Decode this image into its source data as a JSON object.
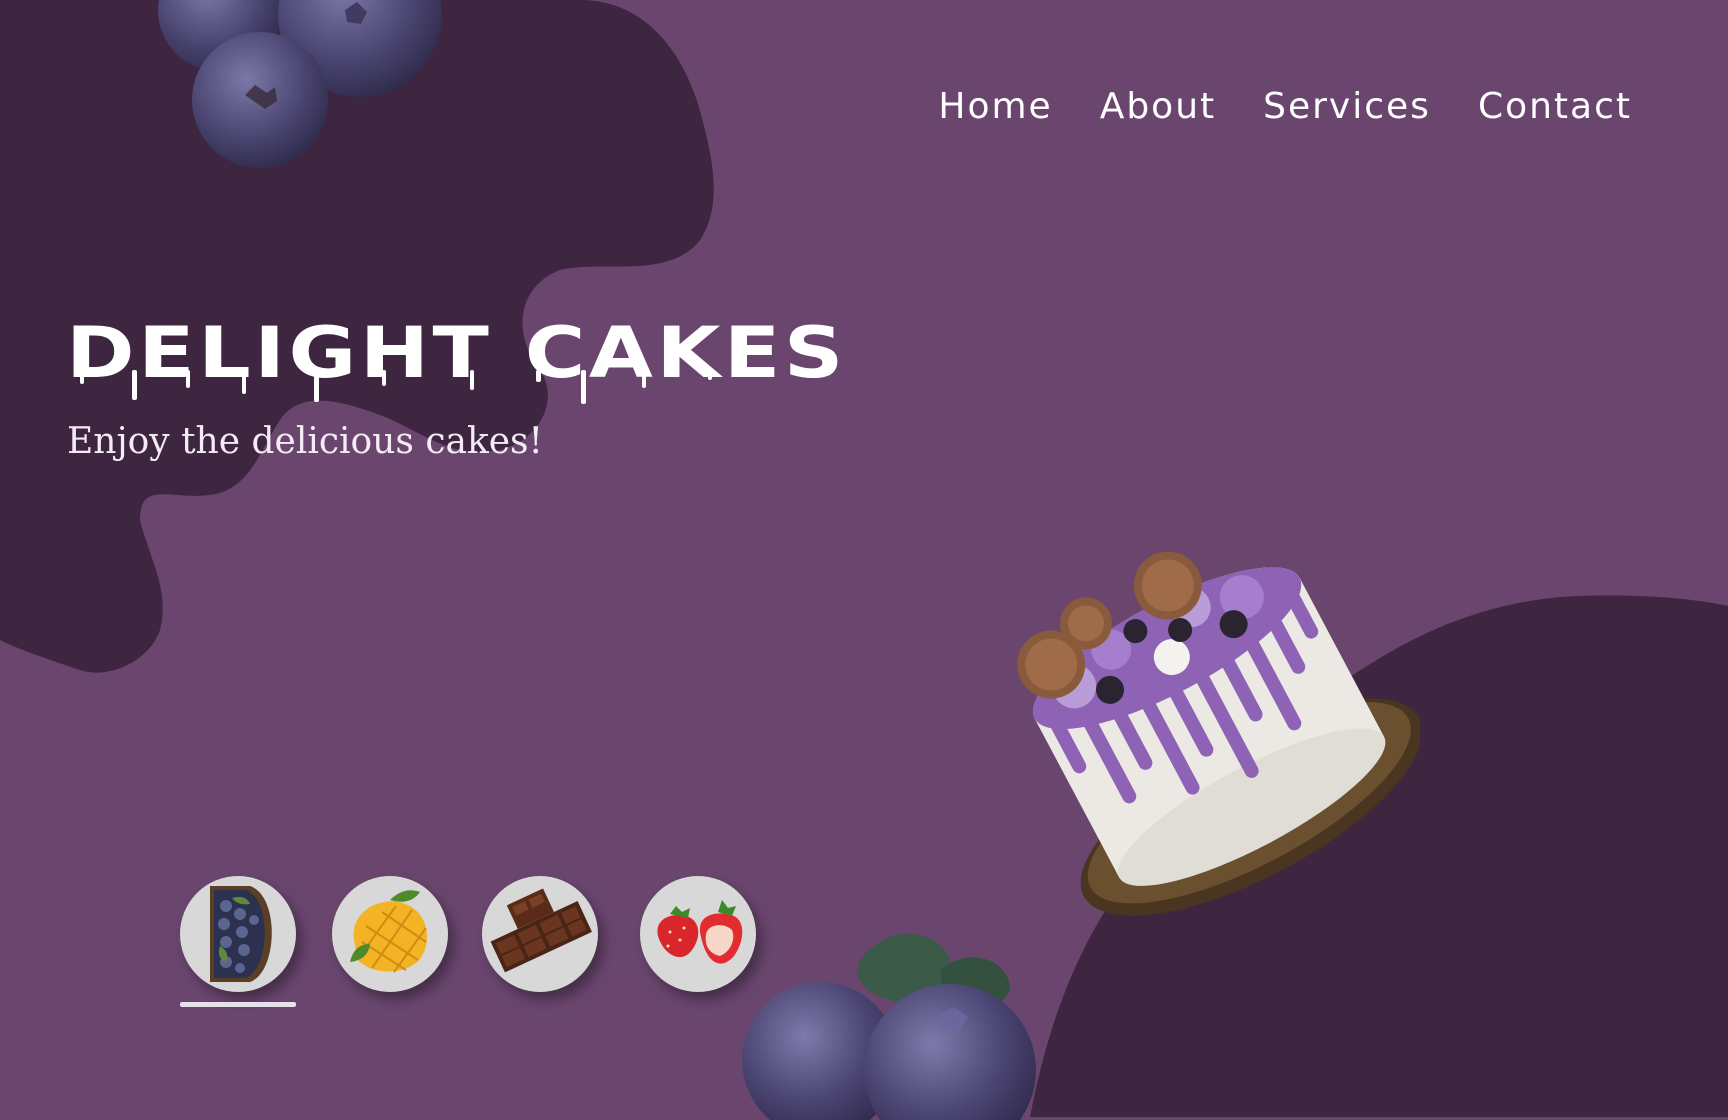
{
  "nav": {
    "items": [
      "Home",
      "About",
      "Services",
      "Contact"
    ]
  },
  "hero": {
    "title": "DELIGHT CAKES",
    "subtitle": "Enjoy the delicious cakes!"
  },
  "flavors": {
    "items": [
      {
        "icon": "blueberry-basket-icon"
      },
      {
        "icon": "mango-icon"
      },
      {
        "icon": "chocolate-icon"
      },
      {
        "icon": "strawberry-icon"
      }
    ],
    "selected_index": 0
  },
  "colors": {
    "background": "#6a466f",
    "dark_blob": "#3e2540",
    "accent_purple": "#8e62b4",
    "text": "#ffffff"
  }
}
